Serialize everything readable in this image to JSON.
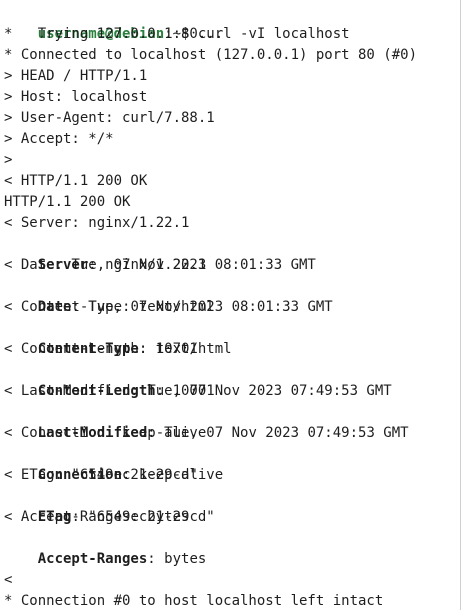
{
  "prompt": {
    "user_host": "username@debian",
    "cwd": ":~$ ",
    "command": "curl -vI localhost"
  },
  "output": {
    "l1": "*   Trying 127.0.0.1:80...",
    "l2": "* Connected to localhost (127.0.0.1) port 80 (#0)",
    "l3": "> HEAD / HTTP/1.1",
    "l4": "> Host: localhost",
    "l5": "> User-Agent: curl/7.88.1",
    "l6": "> Accept: */*",
    "l7": ">",
    "l8": "< HTTP/1.1 200 OK",
    "l9": "HTTP/1.1 200 OK",
    "l10": "< Server: nginx/1.22.1",
    "l11_key": "Server",
    "l11_val": ": nginx/1.22.1",
    "l12": "< Date: Tue, 07 Nov 2023 08:01:33 GMT",
    "l13_key": "Date",
    "l13_val": ": Tue, 07 Nov 2023 08:01:33 GMT",
    "l14": "< Content-Type: text/html",
    "l15_key": "Content-Type",
    "l15_val": ": text/html",
    "l16": "< Content-Length: 10701",
    "l17_key": "Content-Length",
    "l17_val": ": 10701",
    "l18": "< Last-Modified: Tue, 07 Nov 2023 07:49:53 GMT",
    "l19_key": "Last-Modified",
    "l19_val": ": Tue, 07 Nov 2023 07:49:53 GMT",
    "l20": "< Connection: keep-alive",
    "l21_key": "Connection",
    "l21_val": ": keep-alive",
    "l22": "< ETag: \"6549ec21-29cd\"",
    "l23_key": "ETag",
    "l23_val": ": \"6549ec21-29cd\"",
    "l24": "< Accept-Ranges: bytes",
    "l25_key": "Accept-Ranges",
    "l25_val": ": bytes",
    "l27": "<",
    "l28": "* Connection #0 to host localhost left intact"
  }
}
